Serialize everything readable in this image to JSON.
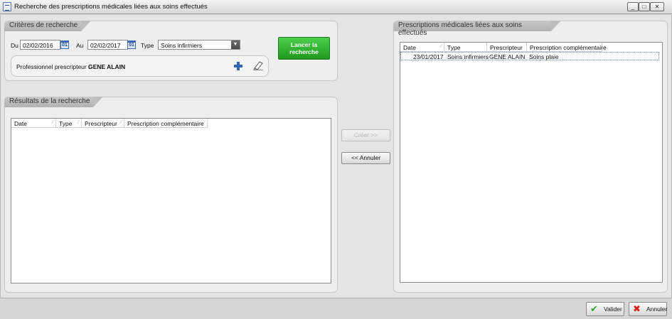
{
  "window": {
    "title": "Recherche des prescriptions médicales liées aux soins effectués",
    "minimize_label": "_",
    "maximize_label": "□",
    "close_label": "✕"
  },
  "criteria": {
    "tab_label": "Critères de recherche",
    "du_label": "Du",
    "du_value": "02/02/2016",
    "au_label": "Au",
    "au_value": "02/02/2017",
    "calendar_label": "01",
    "type_label": "Type",
    "type_value": "Soins infirmiers",
    "launch_button": "Lancer la recherche",
    "prescriber_label": "Professionnel prescripteur :",
    "prescriber_value": "GENE ALAIN"
  },
  "results": {
    "tab_label": "Résultats de la recherche",
    "columns": [
      "Date",
      "Type",
      "Prescripteur",
      "Prescription complémentaire"
    ]
  },
  "middle": {
    "create_button": "Créer >>",
    "cancel_button": "<< Annuler"
  },
  "linked": {
    "tab_label": "Prescriptions médicales liées aux soins effectués",
    "columns": [
      "Date",
      "Type",
      "Prescripteur",
      "Prescription complémentaire"
    ],
    "rows": [
      [
        "23/01/2017",
        "Soins infirmiers",
        "GENE ALAIN",
        "Soins plaie"
      ]
    ]
  },
  "footer": {
    "validate_button": "Valider",
    "cancel_button": "Annuler"
  },
  "colors": {
    "accent_green": "#2fb52f",
    "accent_blue": "#2f66b3",
    "cancel_red": "#d12020"
  }
}
